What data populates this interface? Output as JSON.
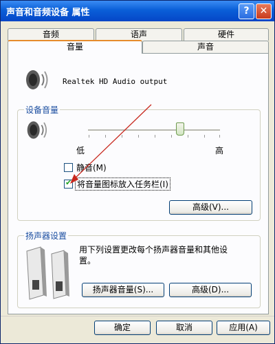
{
  "window": {
    "title": "声音和音频设备 属性"
  },
  "tabs_row1": [
    "音频",
    "语声",
    "硬件"
  ],
  "tabs_row2": [
    "音量",
    "声音"
  ],
  "device": {
    "name": "Realtek HD Audio output"
  },
  "device_volume": {
    "group_label": "设备音量",
    "low_label": "低",
    "high_label": "高",
    "level_percent": 70,
    "mute_label": "静音(M)",
    "mute_checked": false,
    "tray_label": "将音量图标放入任务栏(I)",
    "tray_checked": true,
    "advanced_button": "高级(V)..."
  },
  "speaker_settings": {
    "group_label": "扬声器设置",
    "description_line1": "用下列设置更改每个扬声器音量和其他设",
    "description_line2": "置。",
    "speaker_volume_button": "扬声器音量(S)...",
    "advanced_button": "高级(D)..."
  },
  "footer": {
    "ok": "确定",
    "cancel": "取消",
    "apply": "应用(A)"
  },
  "icons": [
    "help-icon",
    "close-icon",
    "speaker-icon",
    "speaker-pair-icon"
  ],
  "colors": {
    "titlebar": "#0a5fd8",
    "accent_tab": "#e68b2c",
    "group_label": "#1b4ea0"
  }
}
